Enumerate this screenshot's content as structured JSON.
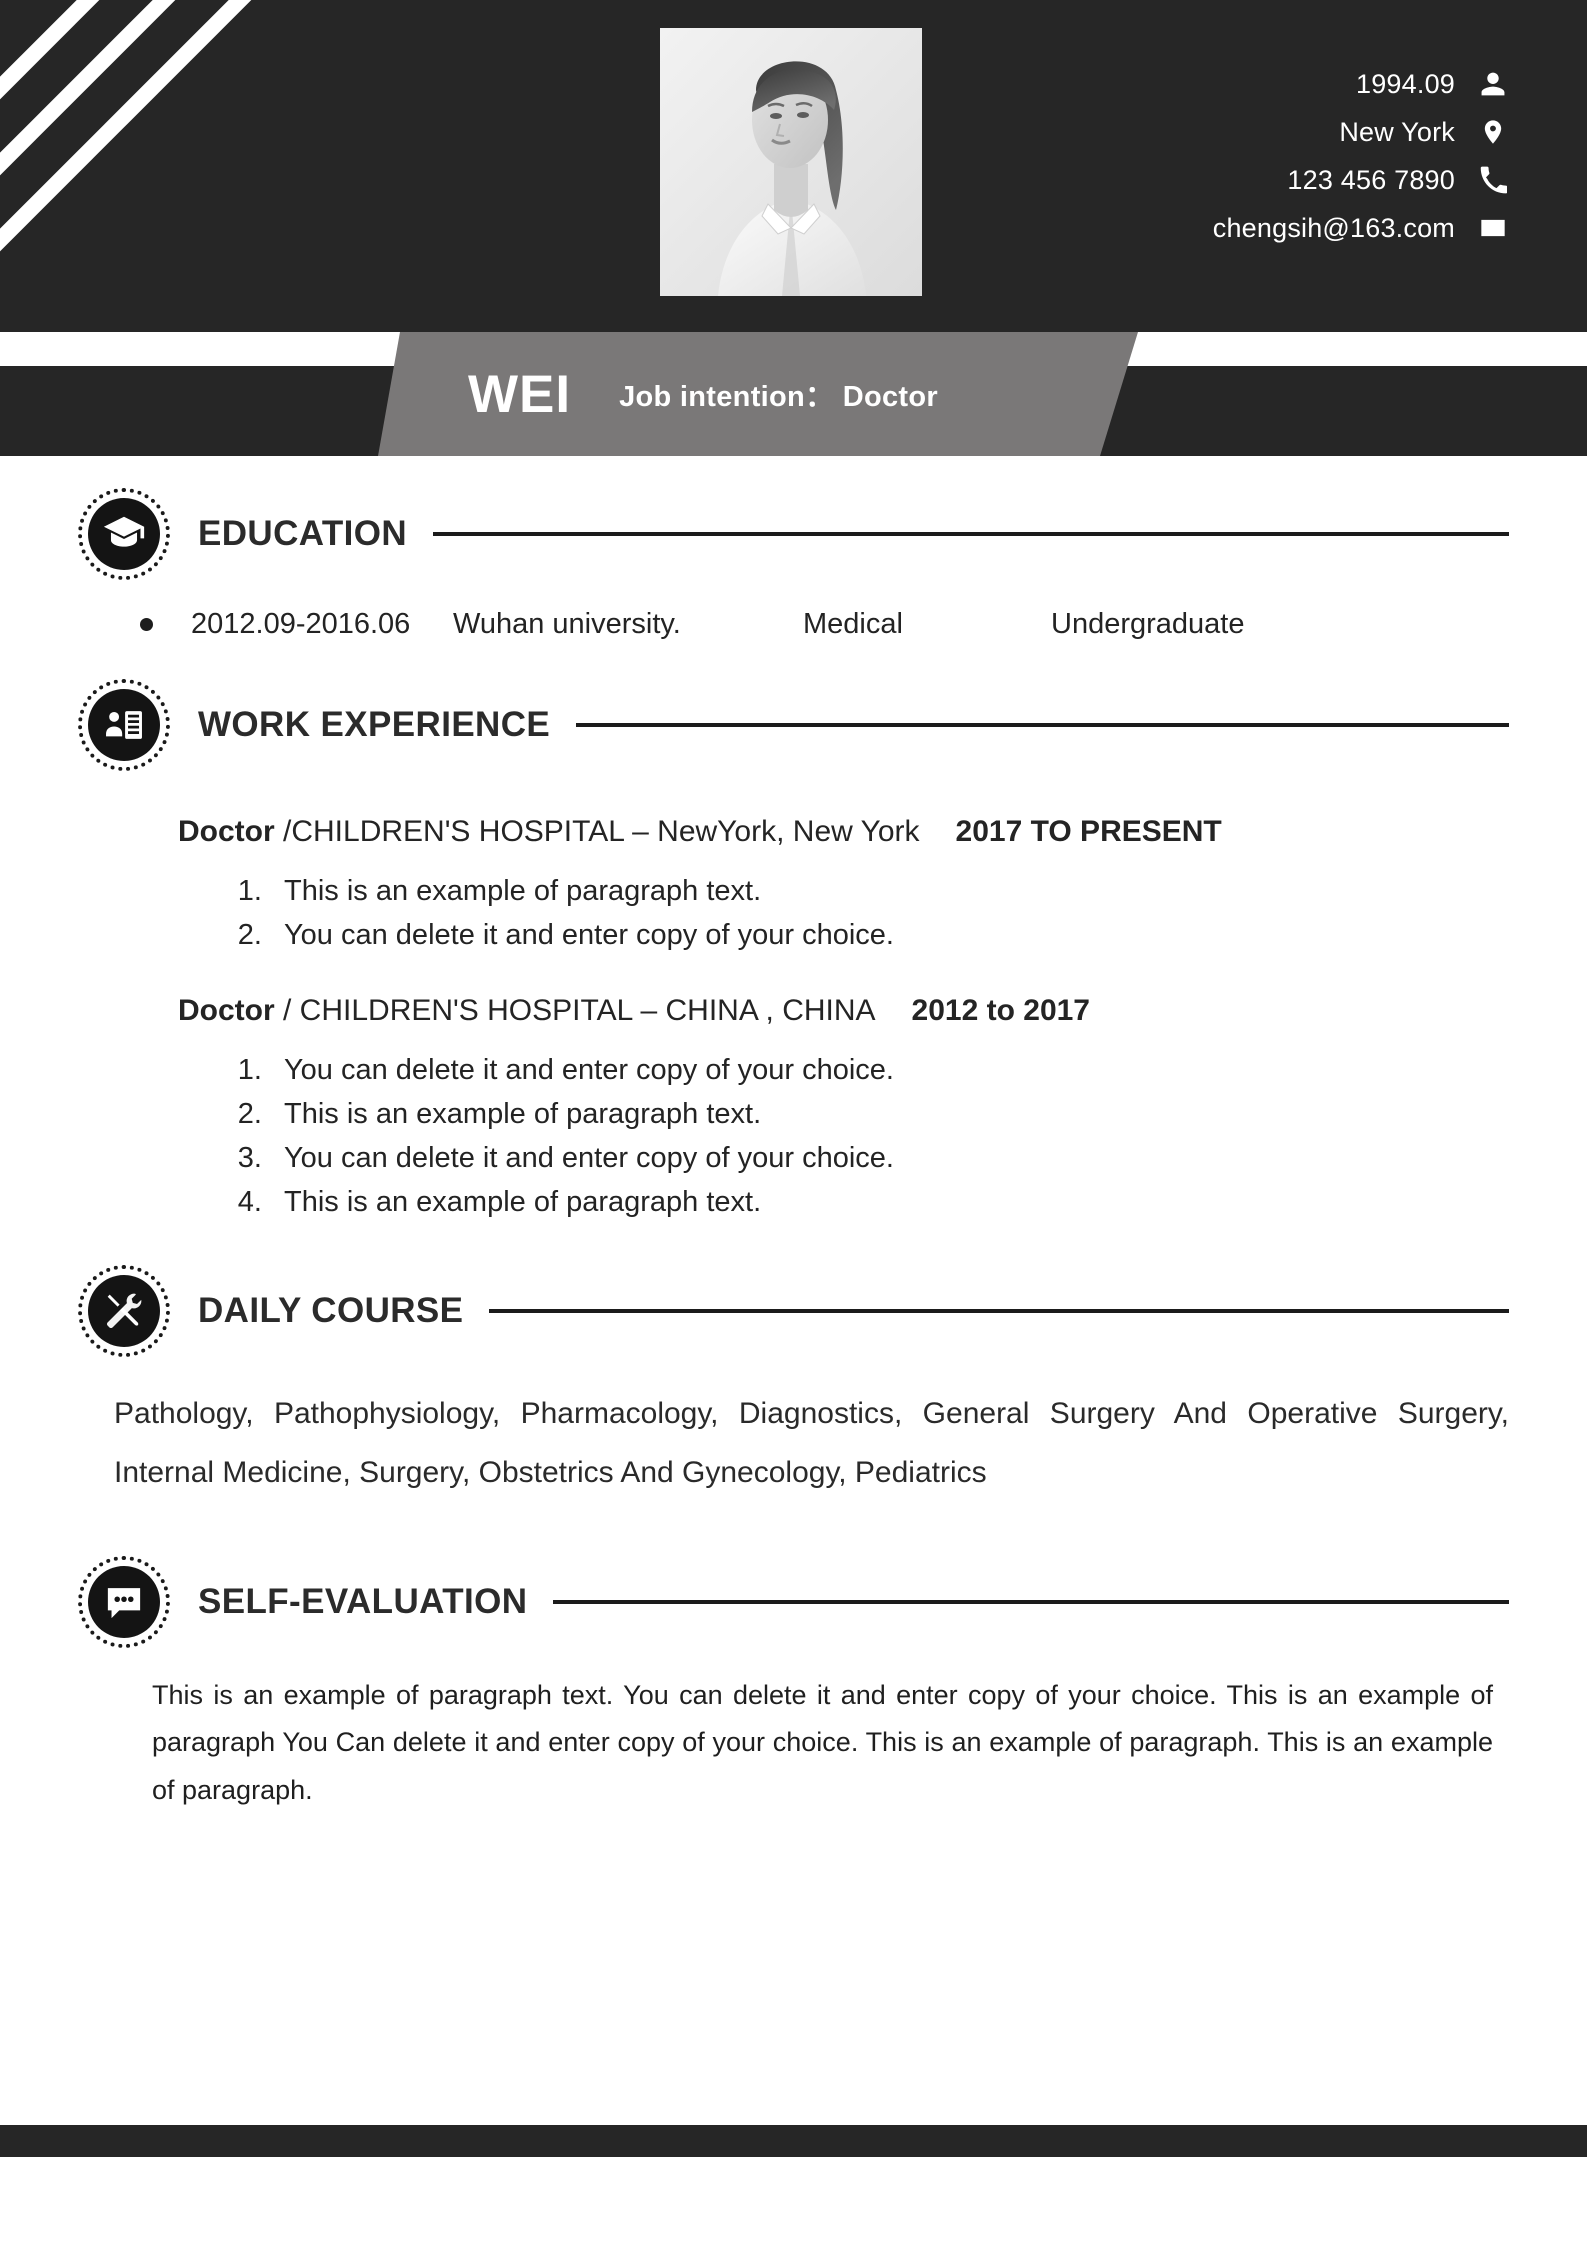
{
  "theme": {
    "dark": "#262626",
    "gray_plate": "#7a7878",
    "text": "#1d1d1d",
    "white": "#ffffff"
  },
  "header": {
    "contact": [
      {
        "icon": "person-icon",
        "value": "1994.09"
      },
      {
        "icon": "location-icon",
        "value": "New York"
      },
      {
        "icon": "phone-icon",
        "value": "123 456 7890"
      },
      {
        "icon": "email-icon",
        "value": "chengsih@163.com"
      }
    ],
    "photo_alt": "profile-photo"
  },
  "name_band": {
    "name": "WEI",
    "job_intention": "Job intention： Doctor"
  },
  "sections": {
    "education": {
      "title": "EDUCATION",
      "icon": "graduation-cap-icon",
      "entries": [
        {
          "date": "2012.09-2016.06",
          "school": "Wuhan university.",
          "major": "Medical",
          "degree": "Undergraduate"
        }
      ]
    },
    "work": {
      "title": "WORK EXPERIENCE",
      "icon": "id-card-icon",
      "jobs": [
        {
          "role": "Doctor",
          "detail": "/CHILDREN'S HOSPITAL – NewYork, New York",
          "date": "2017 TO PRESENT",
          "items": [
            "This is an example of paragraph text.",
            "You can delete it and enter copy of your choice."
          ]
        },
        {
          "role": "Doctor",
          "detail": "/ CHILDREN'S HOSPITAL – CHINA , CHINA",
          "date": "2012 to 2017",
          "items": [
            "You can delete it and enter copy of your choice.",
            "This is an example of paragraph text.",
            "You can delete it and enter copy of your choice.",
            "This is an example of paragraph text."
          ]
        }
      ]
    },
    "daily_course": {
      "title": "DAILY COURSE",
      "icon": "tools-icon",
      "body": "Pathology, Pathophysiology, Pharmacology, Diagnostics, General Surgery And Operative Surgery, Internal Medicine, Surgery, Obstetrics And Gynecology, Pediatrics"
    },
    "self_evaluation": {
      "title": "SELF-EVALUATION",
      "icon": "chat-bubble-icon",
      "body": "This is an example of paragraph text. You can delete it and enter copy of your choice. This is an example of paragraph You Can delete it and enter copy of your choice. This is an example of paragraph. This is an example of paragraph."
    }
  }
}
